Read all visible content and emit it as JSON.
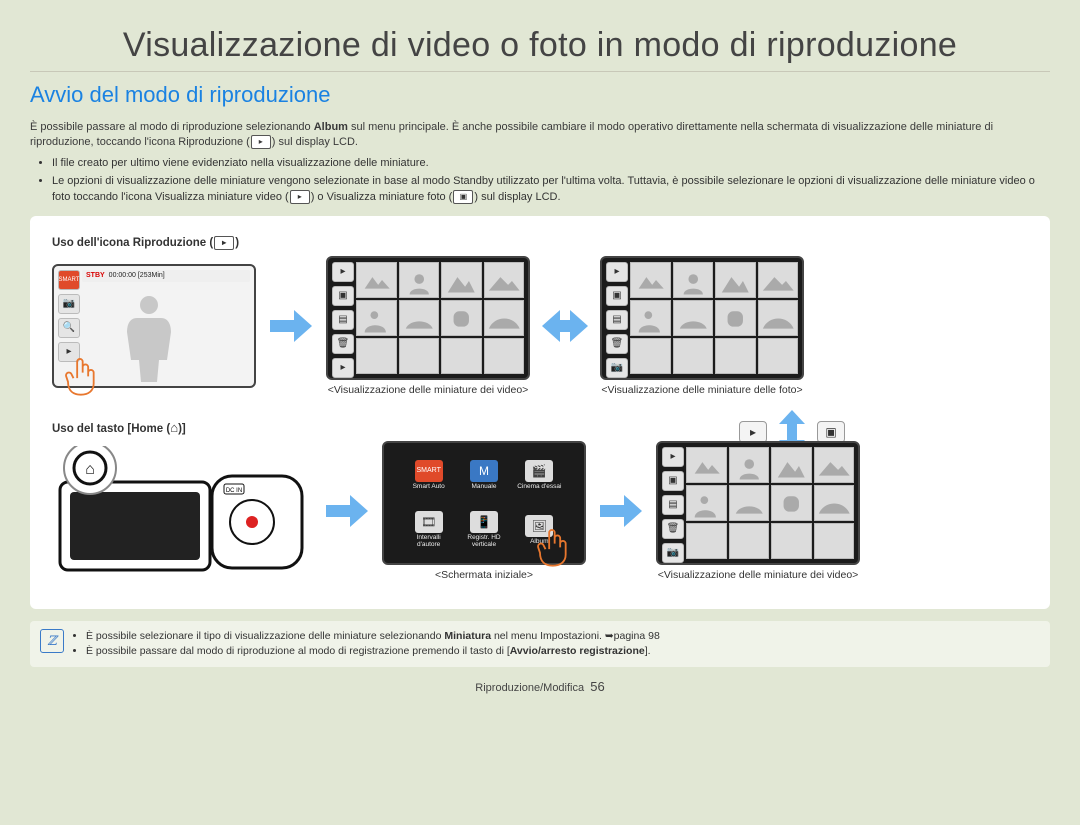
{
  "title": "Visualizzazione di video o foto in modo di riproduzione",
  "subtitle": "Avvio del modo di riproduzione",
  "intro_a": "È possibile passare al modo di riproduzione selezionando ",
  "intro_b_bold": "Album",
  "intro_c": " sul menu principale. È anche possibile cambiare il modo operativo direttamente nella schermata di visualizzazione delle miniature di riproduzione, toccando l'icona Riproduzione (",
  "intro_d": ") sul display LCD.",
  "bul1": "Il file creato per ultimo viene evidenziato nella visualizzazione delle miniature.",
  "bul2_a": "Le opzioni di visualizzazione delle miniature vengono selezionate in base al modo Standby utilizzato per l'ultima volta. Tuttavia, è possibile selezionare le opzioni di visualizzazione delle miniature video o foto toccando l'icona Visualizza miniature video (",
  "bul2_b": ") o Visualizza miniature foto (",
  "bul2_c": ") sul display LCD.",
  "sect_play_icon": "Uso dell'icona Riproduzione (",
  "sect_play_icon_end": ")",
  "sect_home": "Uso del tasto [Home (",
  "sect_home_end": ")]",
  "cap_video_thumb": "<Visualizzazione delle miniature dei video>",
  "cap_photo_thumb": "<Visualizzazione delle miniature delle foto>",
  "cap_home": "<Schermata iniziale>",
  "stby": "STBY",
  "stby_time": "00:00:00 [253Min]",
  "menu": {
    "m0": "Smart Auto",
    "m1": "Manuale",
    "m2": "Cinema d'essai",
    "m3": "Intervalli\nd'autore",
    "m4": "Registr. HD\nverticale",
    "m5": "Album"
  },
  "note1_a": "È possibile selezionare il tipo di visualizzazione delle miniature selezionando ",
  "note1_bold": "Miniatura",
  "note1_b": " nel menu Impostazioni. ➥pagina 98",
  "note2_a": "È possibile passare dal modo di riproduzione al modo di registrazione premendo il tasto di [",
  "note2_bold": "Avvio/arresto registrazione",
  "note2_b": "].",
  "footer_a": "Riproduzione/Modifica",
  "footer_pg": "56"
}
